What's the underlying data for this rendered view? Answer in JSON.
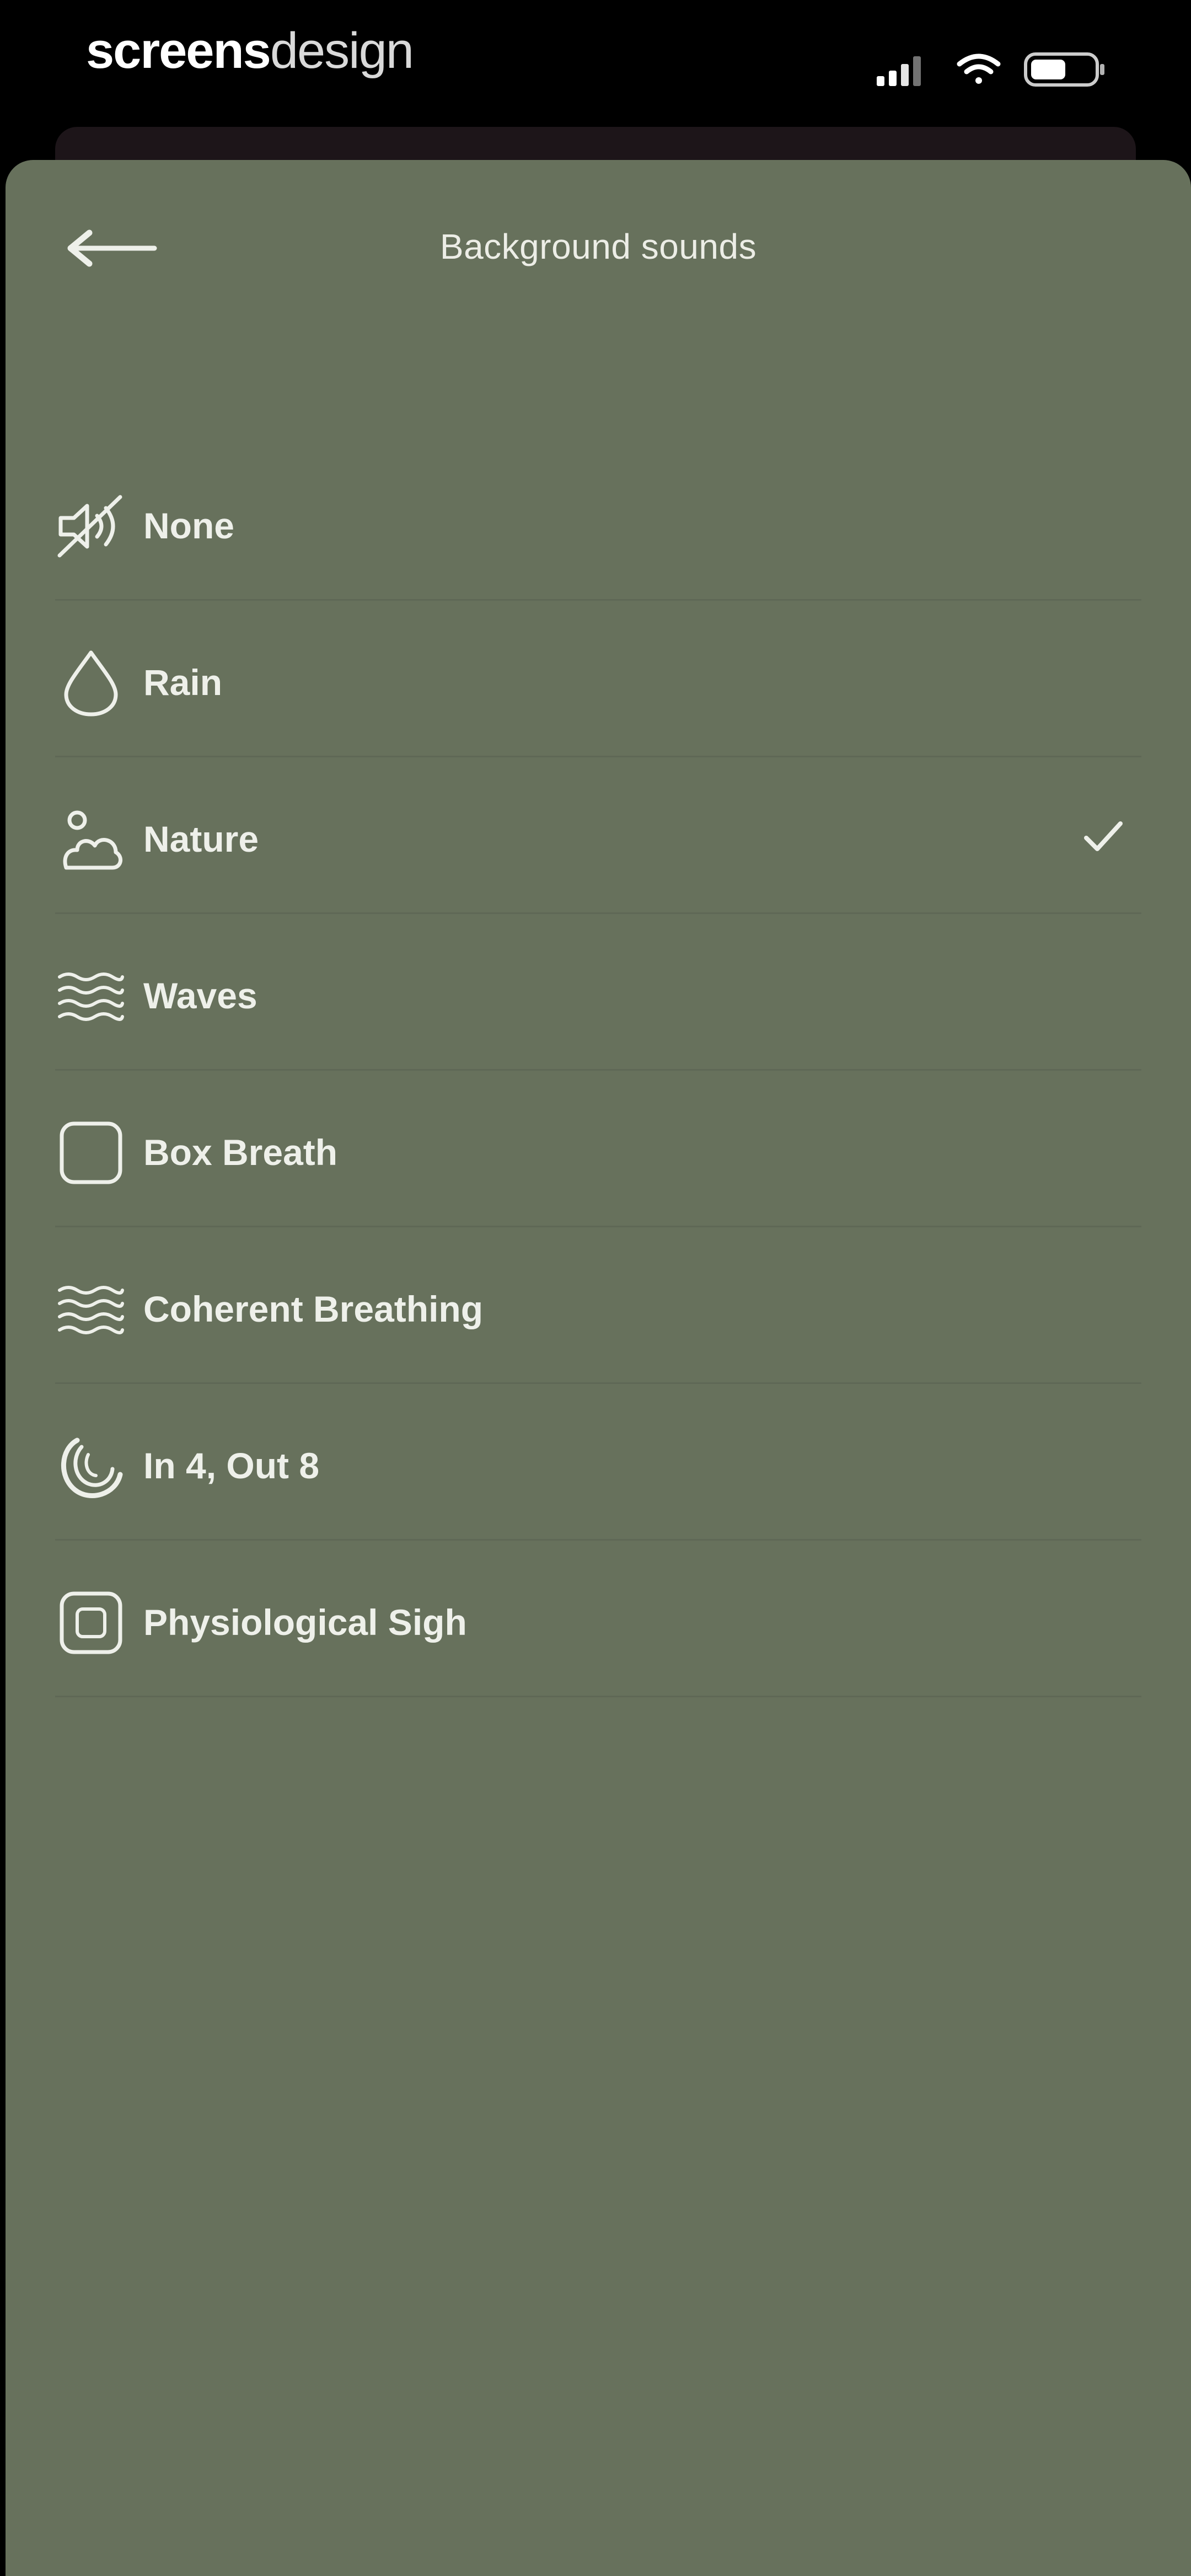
{
  "watermark": {
    "bold": "screens",
    "light": "design"
  },
  "header": {
    "title": "Background sounds",
    "back_icon": "arrow-left-icon"
  },
  "options": [
    {
      "label": "None",
      "icon": "sound-off-icon",
      "selected": false
    },
    {
      "label": "Rain",
      "icon": "droplet-icon",
      "selected": false
    },
    {
      "label": "Nature",
      "icon": "sun-cloud-icon",
      "selected": true
    },
    {
      "label": "Waves",
      "icon": "waves-icon",
      "selected": false
    },
    {
      "label": "Box Breath",
      "icon": "square-icon",
      "selected": false
    },
    {
      "label": "Coherent Breathing",
      "icon": "waves-icon",
      "selected": false
    },
    {
      "label": "In 4, Out 8",
      "icon": "swirl-icon",
      "selected": false
    },
    {
      "label": "Physiological Sigh",
      "icon": "framed-square-icon",
      "selected": false
    }
  ],
  "colors": {
    "sheet": "#67715c",
    "text": "#eef0ea",
    "divider": "#5f6856",
    "background": "#000000"
  }
}
